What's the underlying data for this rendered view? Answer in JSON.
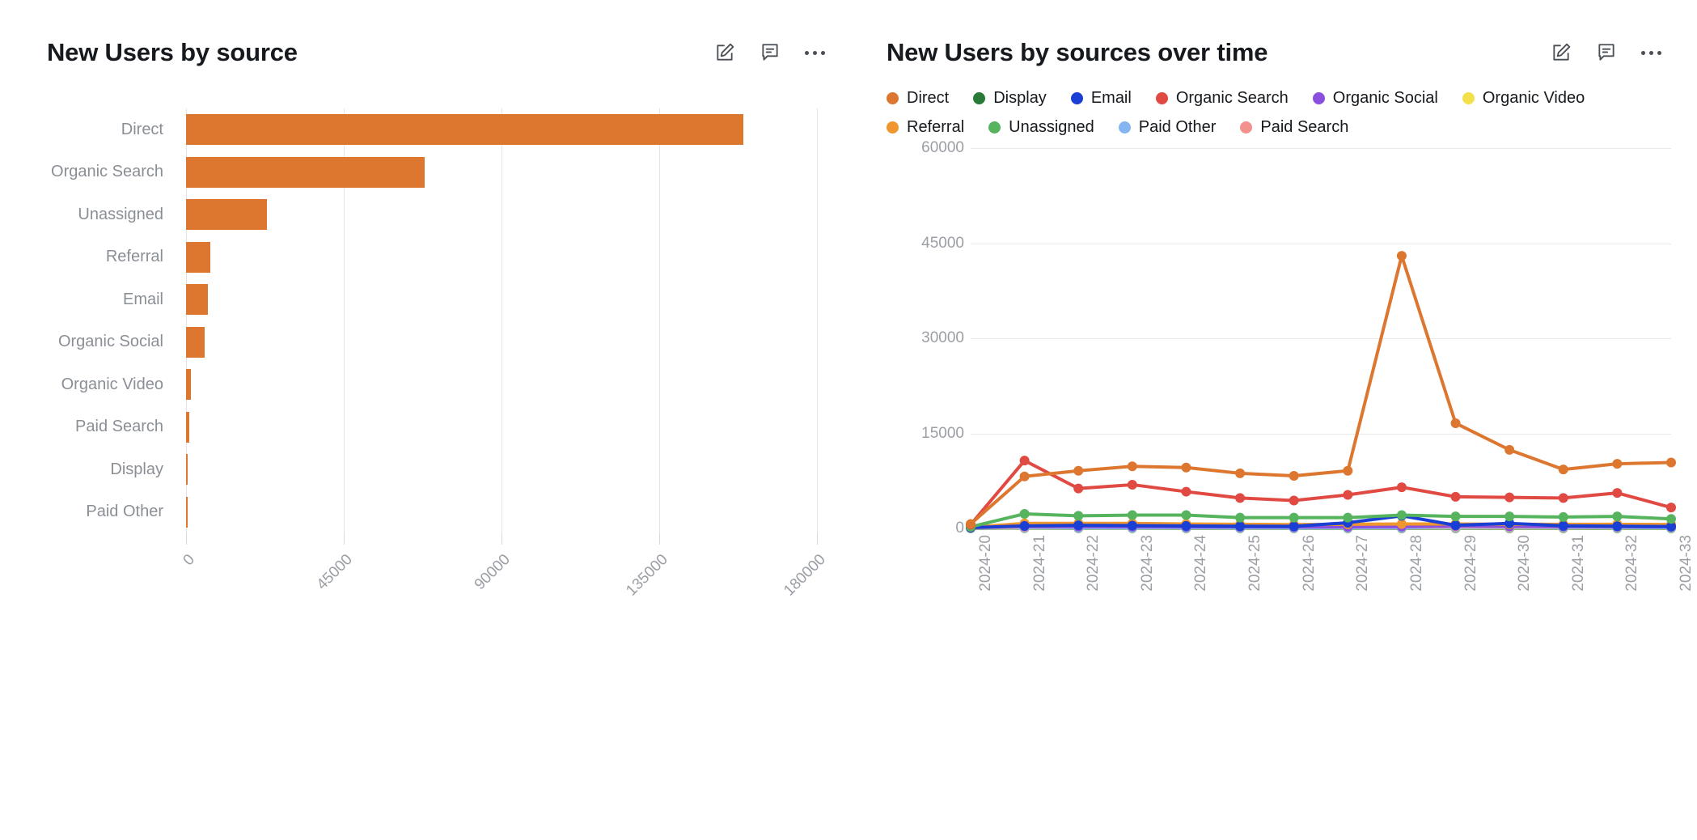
{
  "panels": [
    {
      "title": "New Users by source",
      "icons": {
        "edit": "edit-icon",
        "comment": "comment-icon",
        "more": "more-options-icon"
      }
    },
    {
      "title": "New Users by sources over time",
      "icons": {
        "edit": "edit-icon",
        "comment": "comment-icon",
        "more": "more-options-icon"
      }
    }
  ],
  "legend": [
    {
      "label": "Direct",
      "color": "#dd7730"
    },
    {
      "label": "Display",
      "color": "#277b36"
    },
    {
      "label": "Email",
      "color": "#1a3fd4"
    },
    {
      "label": "Organic Search",
      "color": "#e14a42"
    },
    {
      "label": "Organic Social",
      "color": "#8b4fe0"
    },
    {
      "label": "Organic Video",
      "color": "#f4e04a"
    },
    {
      "label": "Referral",
      "color": "#f0962e"
    },
    {
      "label": "Unassigned",
      "color": "#56b35e"
    },
    {
      "label": "Paid Other",
      "color": "#85b5f0"
    },
    {
      "label": "Paid Search",
      "color": "#f2918e"
    }
  ],
  "chart_data": [
    {
      "type": "bar",
      "title": "New Users by source",
      "orientation": "horizontal",
      "xlabel": "",
      "ylabel": "",
      "xlim": [
        0,
        180000
      ],
      "xticks": [
        0,
        45000,
        90000,
        135000,
        180000
      ],
      "xtick_labels": [
        "0",
        "45000",
        "90000",
        "135000",
        "180000"
      ],
      "grid": true,
      "bar_color": "#dd7730",
      "categories": [
        "Direct",
        "Organic Search",
        "Unassigned",
        "Referral",
        "Email",
        "Organic Social",
        "Organic Video",
        "Paid Search",
        "Display",
        "Paid Other"
      ],
      "values": [
        159000,
        68000,
        23000,
        7000,
        6200,
        5200,
        1400,
        900,
        320,
        80
      ]
    },
    {
      "type": "line",
      "title": "New Users by sources over time",
      "xlabel": "",
      "ylabel": "",
      "ylim": [
        0,
        60000
      ],
      "yticks": [
        0,
        15000,
        30000,
        45000,
        60000
      ],
      "ytick_labels": [
        "0",
        "15000",
        "30000",
        "45000",
        "60000"
      ],
      "grid": true,
      "legend_position": "top",
      "x": [
        "2024-20",
        "2024-21",
        "2024-22",
        "2024-23",
        "2024-24",
        "2024-25",
        "2024-26",
        "2024-27",
        "2024-28",
        "2024-29",
        "2024-30",
        "2024-31",
        "2024-32",
        "2024-33"
      ],
      "series": [
        {
          "name": "Direct",
          "color": "#dd7730",
          "values": [
            700,
            8200,
            9100,
            9800,
            9600,
            8700,
            8300,
            9100,
            43000,
            16600,
            12400,
            9300,
            10200,
            10400
          ]
        },
        {
          "name": "Organic Search",
          "color": "#e14a42",
          "values": [
            600,
            10700,
            6300,
            6900,
            5800,
            4800,
            4400,
            5300,
            6500,
            5000,
            4900,
            4800,
            5600,
            3300
          ]
        },
        {
          "name": "Unassigned",
          "color": "#56b35e",
          "values": [
            250,
            2300,
            2000,
            2100,
            2100,
            1700,
            1700,
            1700,
            2100,
            1900,
            1900,
            1800,
            1900,
            1500
          ]
        },
        {
          "name": "Referral",
          "color": "#f0962e",
          "values": [
            180,
            800,
            800,
            800,
            700,
            650,
            600,
            650,
            700,
            700,
            650,
            650,
            650,
            620
          ]
        },
        {
          "name": "Email",
          "color": "#1a3fd4",
          "values": [
            120,
            400,
            500,
            450,
            400,
            350,
            330,
            900,
            2000,
            500,
            800,
            420,
            350,
            300
          ]
        },
        {
          "name": "Paid Search",
          "color": "#f2918e",
          "values": [
            100,
            260,
            300,
            300,
            280,
            280,
            260,
            280,
            280,
            280,
            270,
            270,
            270,
            250
          ]
        },
        {
          "name": "Organic Social",
          "color": "#8b4fe0",
          "values": [
            420,
            330,
            300,
            280,
            260,
            250,
            240,
            250,
            280,
            420,
            330,
            300,
            280,
            250
          ]
        },
        {
          "name": "Paid Other",
          "color": "#85b5f0",
          "values": [
            60,
            120,
            120,
            110,
            110,
            110,
            100,
            110,
            110,
            150,
            160,
            150,
            140,
            130
          ]
        },
        {
          "name": "Organic Video",
          "color": "#f4e04a",
          "values": [
            40,
            90,
            110,
            110,
            100,
            100,
            90,
            100,
            100,
            100,
            95,
            95,
            95,
            90
          ]
        },
        {
          "name": "Display",
          "color": "#277b36",
          "values": [
            20,
            40,
            40,
            40,
            35,
            35,
            30,
            35,
            35,
            35,
            35,
            30,
            30,
            30
          ]
        }
      ]
    }
  ]
}
